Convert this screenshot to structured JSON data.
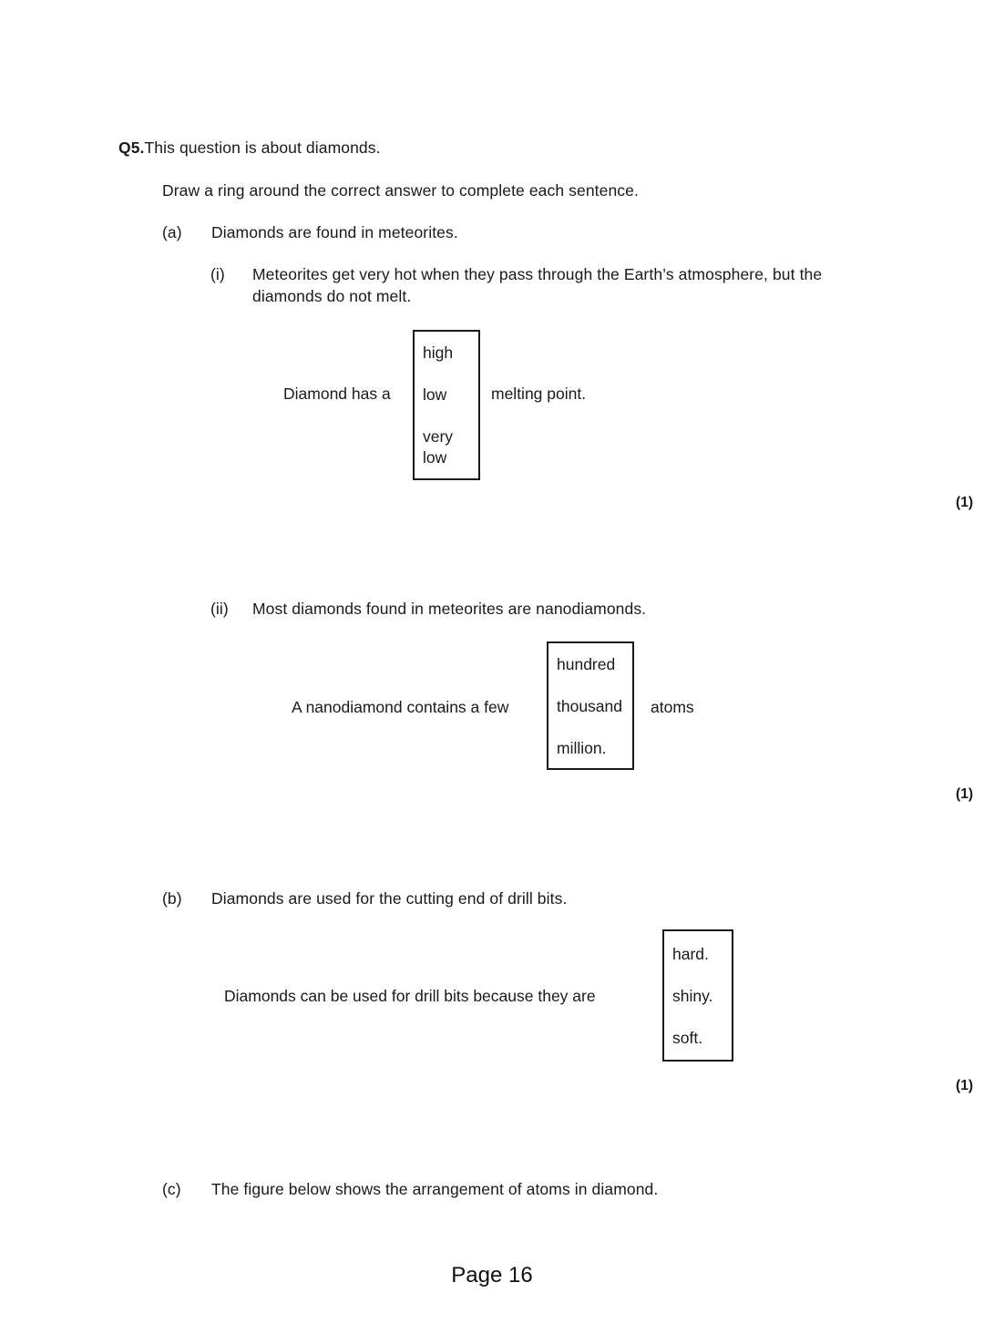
{
  "question": {
    "number": "Q5.",
    "stem": "This question is about diamonds.",
    "instruction": "Draw a ring around the correct answer to complete each sentence."
  },
  "parts": {
    "a": {
      "label": "(a)",
      "text": "Diamonds are found in meteorites.",
      "i": {
        "label": "(i)",
        "text": "Meteorites get very hot when they pass through the Earth’s atmosphere, but the diamonds do not melt.",
        "sentence_before": "Diamond has a",
        "sentence_after": "melting point.",
        "options": [
          "high",
          "low",
          "very low"
        ],
        "mark": "(1)"
      },
      "ii": {
        "label": "(ii)",
        "text": "Most diamonds found in meteorites are nanodiamonds.",
        "sentence_before": "A nanodiamond contains a few",
        "sentence_after": "atoms",
        "options": [
          "hundred",
          "thousand",
          "million."
        ],
        "mark": "(1)"
      }
    },
    "b": {
      "label": "(b)",
      "text": "Diamonds are used for the cutting end of drill bits.",
      "sentence_before": "Diamonds can be used for drill bits because they are",
      "sentence_after": "",
      "options": [
        "hard.",
        "shiny.",
        "soft."
      ],
      "mark": "(1)"
    },
    "c": {
      "label": "(c)",
      "text": "The figure below shows the arrangement of atoms in diamond."
    }
  },
  "footer": {
    "page_label": "Page 16"
  },
  "colors": {
    "text": "#1a1a1a",
    "border": "#1a1a1a",
    "background": "#ffffff"
  }
}
